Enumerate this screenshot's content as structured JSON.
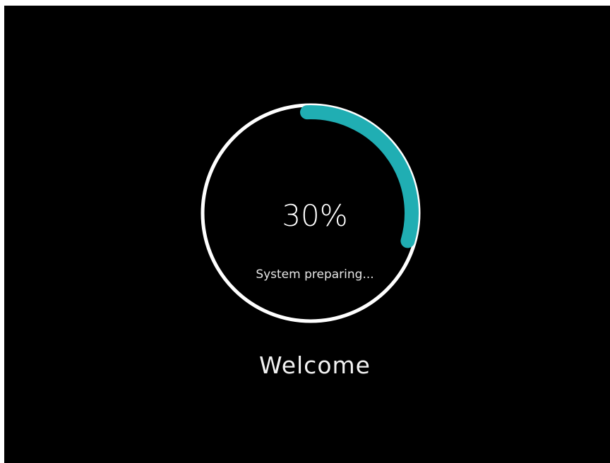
{
  "loader": {
    "percent_text": "30%",
    "progress": 0.3,
    "status_text": "System preparing...",
    "track_color": "#ffffff",
    "progress_color": "#20aeb3"
  },
  "welcome_text": "Welcome"
}
